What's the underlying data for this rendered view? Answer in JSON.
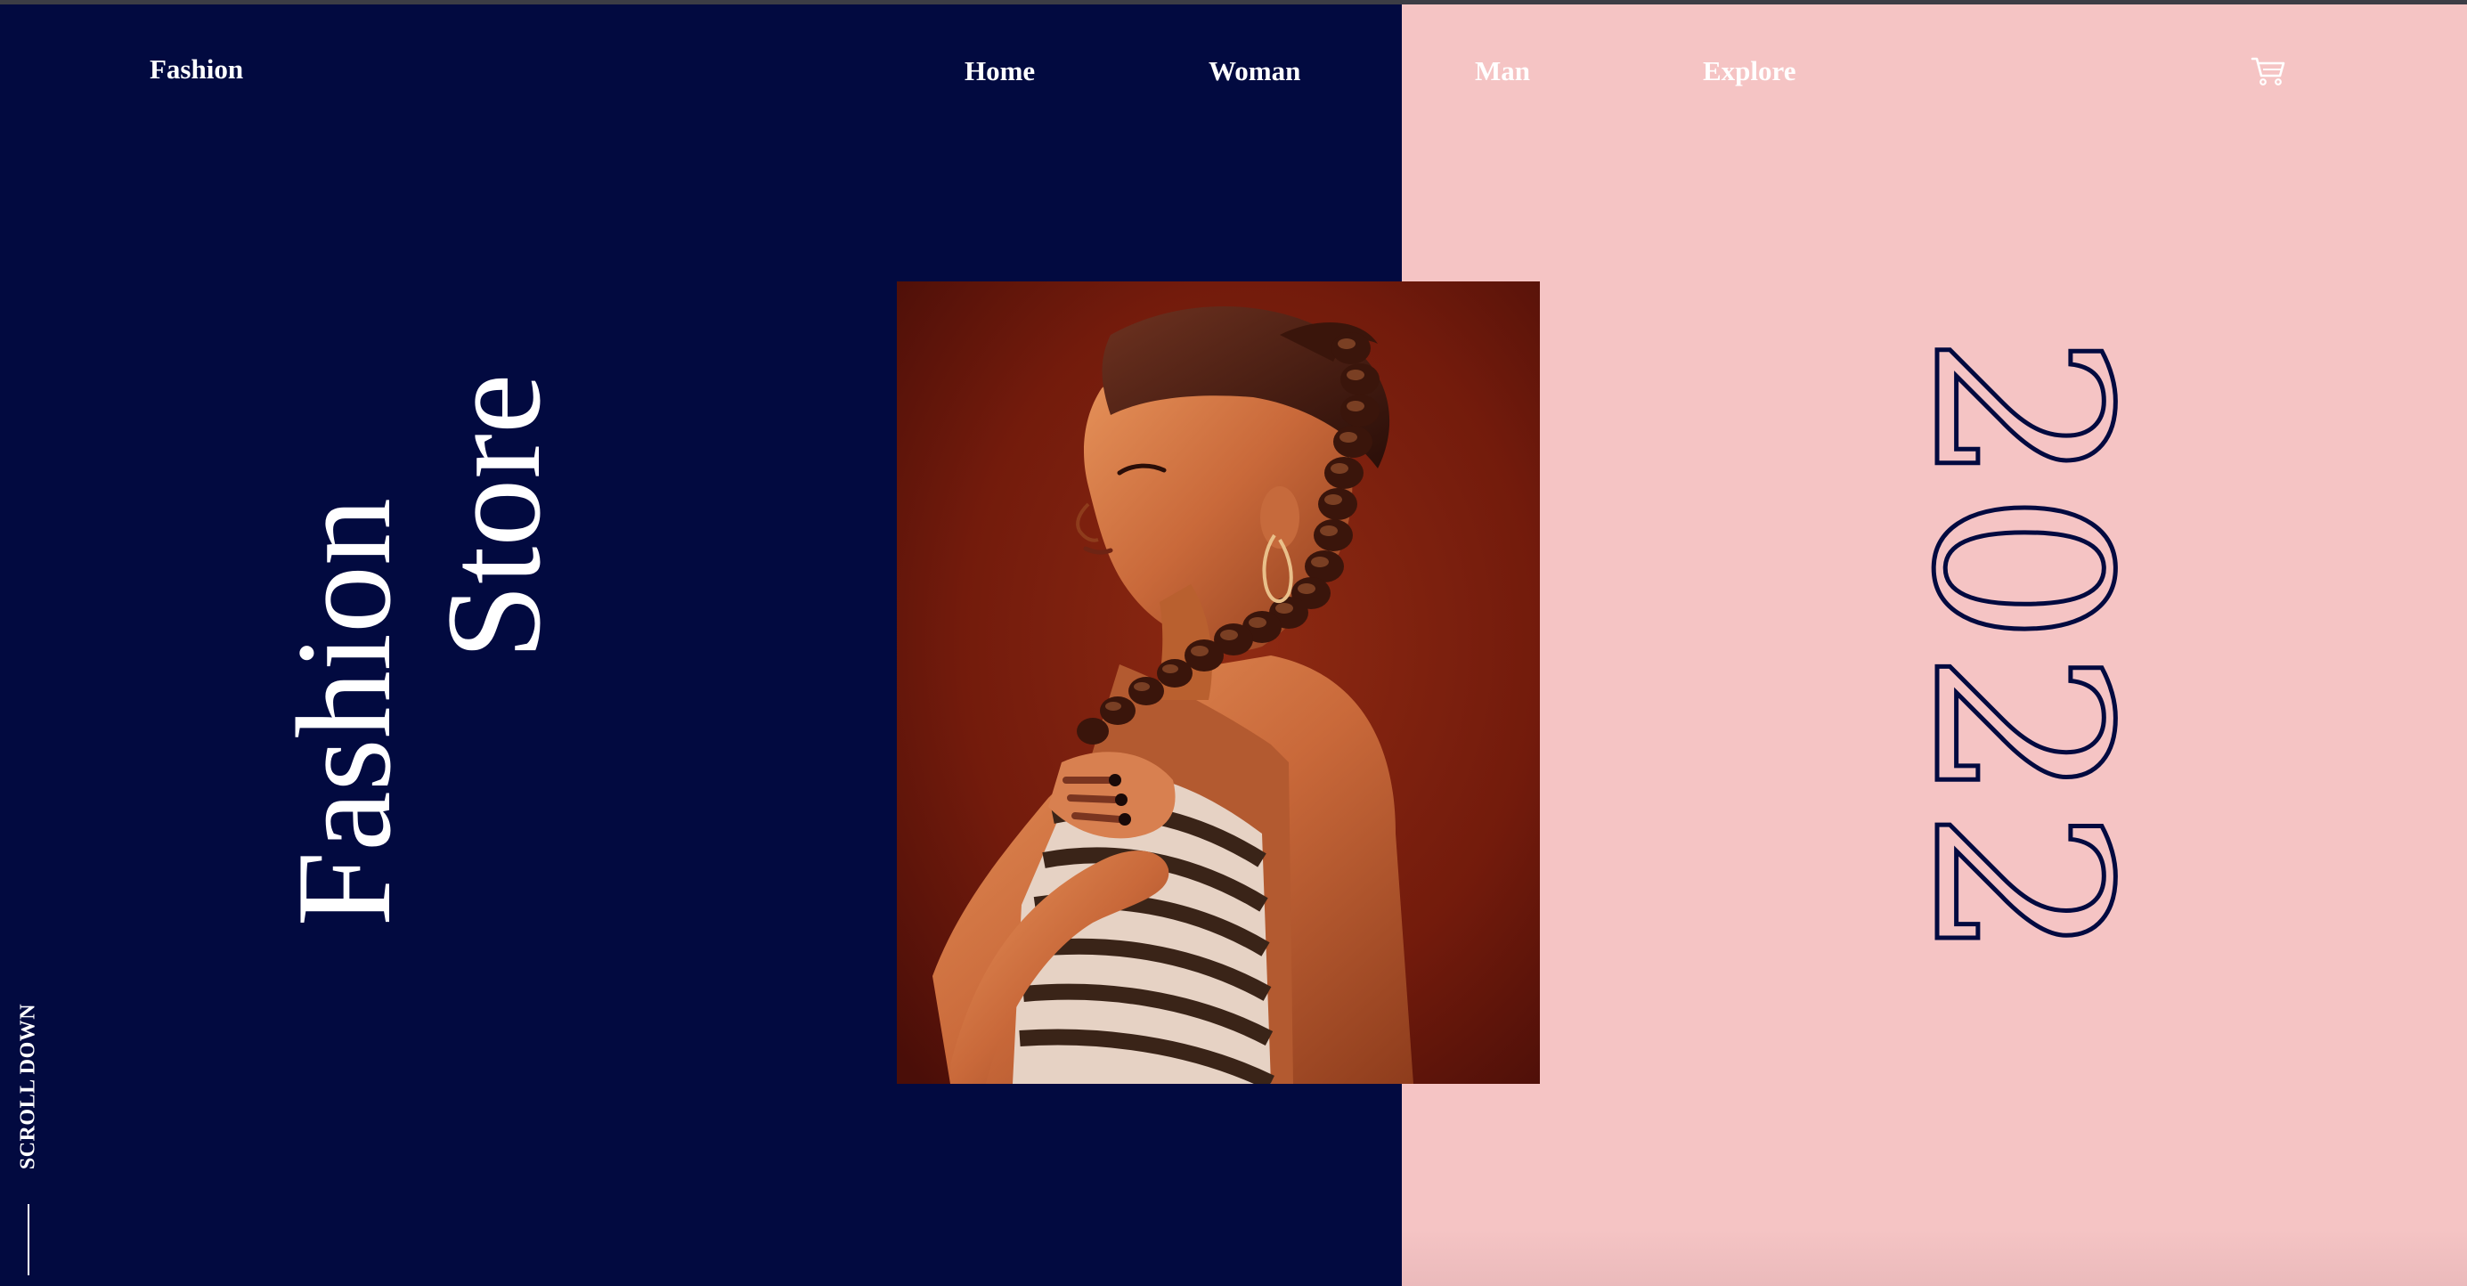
{
  "header": {
    "brand": "Fashion",
    "nav": {
      "home": "Home",
      "woman": "Woman",
      "man": "Man",
      "explore": "Explore"
    },
    "cart_icon": "cart-icon"
  },
  "hero": {
    "line1": "Fashion",
    "line2": "Store",
    "year": "2022"
  },
  "scroll": {
    "label": "SCROLL DOWN"
  },
  "colors": {
    "navy": "#020a40",
    "pink": "#f5c4c4",
    "photo_bg": "#7a1a0b"
  }
}
